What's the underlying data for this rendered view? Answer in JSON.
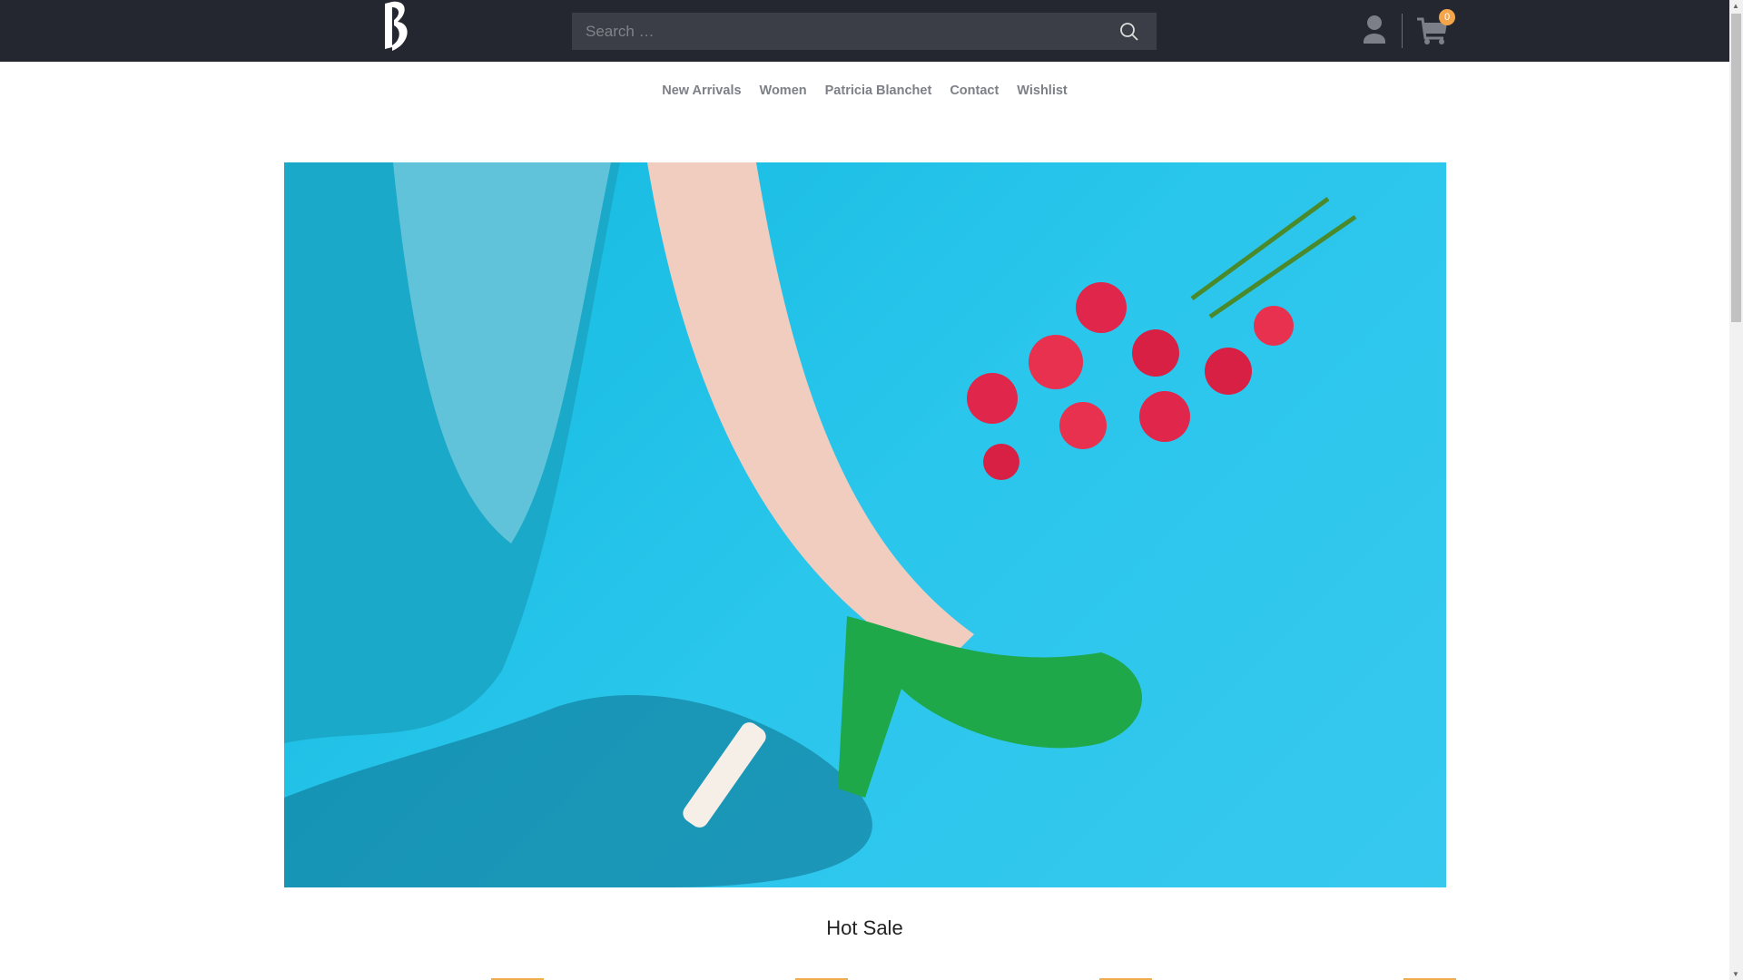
{
  "header": {
    "logo_text": "PB",
    "search_placeholder": "Search …",
    "cart_count": "0"
  },
  "nav": {
    "items": [
      "New Arrivals",
      "Women",
      "Patricia Blanchet",
      "Contact",
      "Wishlist"
    ]
  },
  "section": {
    "title": "Hot Sale"
  },
  "colors": {
    "header_bg": "#252730",
    "accent": "#f0ad4e",
    "hero_bg": "#2ac6ec"
  }
}
